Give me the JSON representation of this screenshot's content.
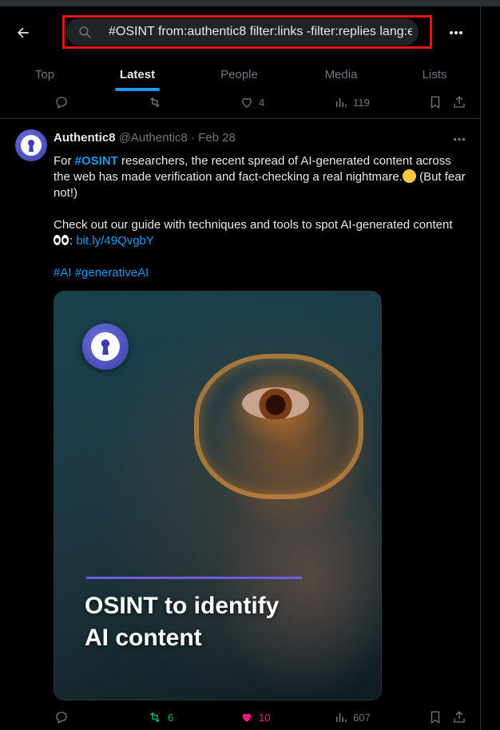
{
  "search": {
    "query": "#OSINT from:authentic8 filter:links -filter:replies lang:e"
  },
  "tabs": [
    {
      "label": "Top",
      "active": false
    },
    {
      "label": "Latest",
      "active": true
    },
    {
      "label": "People",
      "active": false
    },
    {
      "label": "Media",
      "active": false
    },
    {
      "label": "Lists",
      "active": false
    }
  ],
  "previous_tweet": {
    "likes": "4",
    "views": "119"
  },
  "tweet": {
    "author_name": "Authentic8",
    "author_handle": "@Authentic8",
    "separator": "·",
    "date": "Feb 28",
    "text_p1_before": "For ",
    "text_p1_hashtag": "#OSINT",
    "text_p1_after": " researchers, the recent spread of AI-generated content across the web has made verification and fact-checking a real nightmare.",
    "text_p1_end": " (But fear not!)",
    "text_p2_before": "Check out our guide with techniques and tools to spot AI-generated content ",
    "text_p2_colon": ": ",
    "text_p2_link": "bit.ly/49QvgbY",
    "hashtag_1": "#AI",
    "hashtag_2": "#generativeAI",
    "media_headline_1": "OSINT to identify",
    "media_headline_2": "AI content",
    "retweets": "6",
    "likes": "10",
    "views": "607"
  },
  "colors": {
    "accent": "#1d9bf0",
    "like": "#f91880",
    "retweet": "#00ba7c",
    "highlight_box": "#e3141b"
  },
  "icons": [
    "back-arrow-icon",
    "search-icon",
    "more-icon",
    "reply-icon",
    "retweet-icon",
    "like-icon",
    "views-icon",
    "bookmark-icon",
    "share-icon"
  ]
}
